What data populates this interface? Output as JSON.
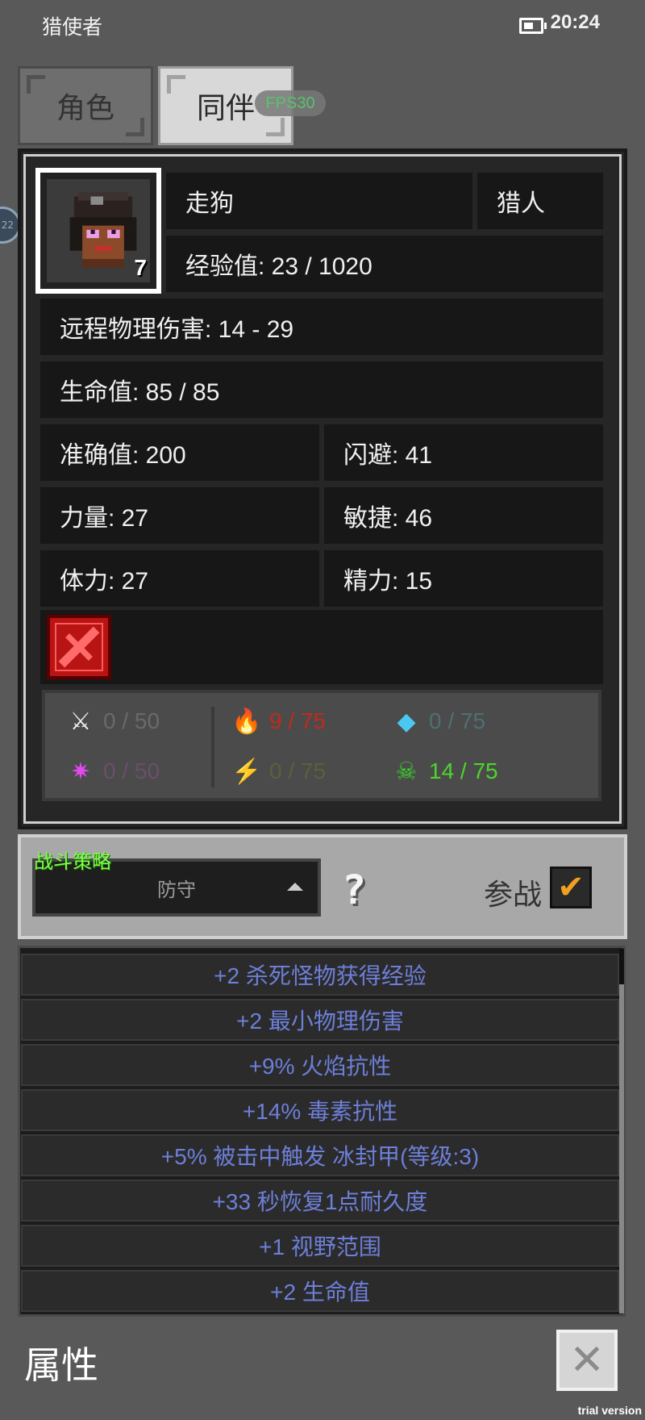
{
  "status": {
    "app_title": "猎使者",
    "time": "20:24"
  },
  "tabs": [
    {
      "label": "角色"
    },
    {
      "label": "同伴"
    }
  ],
  "fps_badge": "FPS30",
  "side_badge": "22",
  "companion": {
    "name": "走狗",
    "class": "猎人",
    "level": "7",
    "exp": "经验值: 23 / 1020",
    "damage": "远程物理伤害: 14 - 29",
    "hp": "生命值: 85 / 85",
    "accuracy": "准确值: 200",
    "dodge": "闪避: 41",
    "strength": "力量: 27",
    "agility": "敏捷: 46",
    "stamina": "体力: 27",
    "spirit": "精力: 15"
  },
  "resists": [
    {
      "icon": "sword-physical-icon",
      "value": "0 / 50",
      "color": "#6a6a6a"
    },
    {
      "icon": "fire-icon",
      "value": "9 / 75",
      "color": "#c22a1a"
    },
    {
      "icon": "ice-icon",
      "value": "0 / 75",
      "color": "#4f6f74"
    },
    {
      "icon": "arcane-icon",
      "value": "0 / 50",
      "color": "#6a4f6a"
    },
    {
      "icon": "lightning-icon",
      "value": "0 / 75",
      "color": "#5e5e3c"
    },
    {
      "icon": "poison-icon",
      "value": "14 / 75",
      "color": "#4cd62b"
    }
  ],
  "strategy": {
    "title": "战斗策略",
    "selected": "防守",
    "join_label": "参战",
    "help": "?"
  },
  "bonuses": [
    "+2 杀死怪物获得经验",
    "+2 最小物理伤害",
    "+9% 火焰抗性",
    "+14% 毒素抗性",
    "+5% 被击中触发 冰封甲(等级:3)",
    "+33 秒恢复1点耐久度",
    "+1 视野范围",
    "+2 生命值"
  ],
  "footer": {
    "title": "属性",
    "close": "✕",
    "trial": "trial version"
  }
}
